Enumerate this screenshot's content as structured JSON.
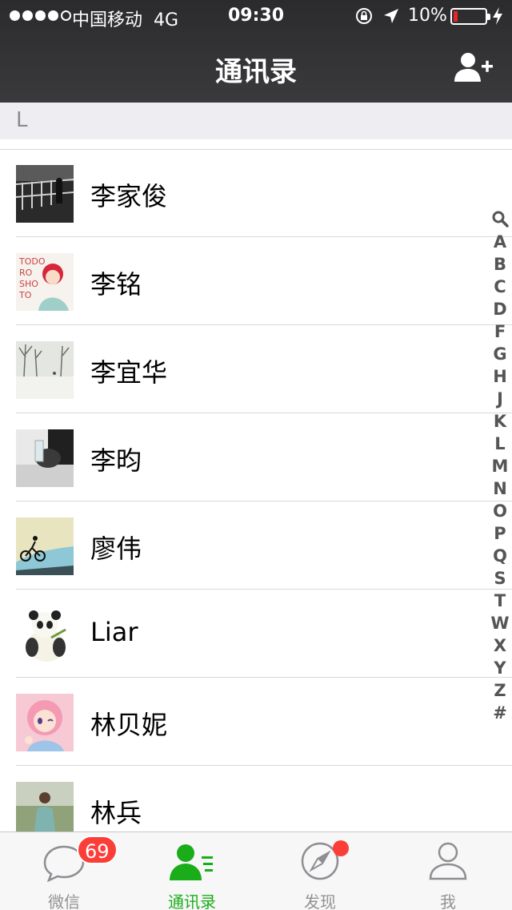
{
  "status_bar": {
    "carrier": "中国移动",
    "network": "4G",
    "time": "09:30",
    "battery_percent": "10%",
    "battery_level": 0.1,
    "signal_bars": 4
  },
  "nav": {
    "title": "通讯录",
    "add_contact_icon": "add-person-icon"
  },
  "section": {
    "letter": "L"
  },
  "contacts": [
    {
      "name": "李家俊",
      "avatar": "night-railing-photo"
    },
    {
      "name": "李铭",
      "avatar": "anime-redhead-todo"
    },
    {
      "name": "李宜华",
      "avatar": "snowy-trees-photo"
    },
    {
      "name": "李昀",
      "avatar": "sleeping-person-photo"
    },
    {
      "name": "廖伟",
      "avatar": "cyclist-silhouette"
    },
    {
      "name": "Liar",
      "avatar": "panda-illustration"
    },
    {
      "name": "林贝妮",
      "avatar": "pink-anime-girl"
    },
    {
      "name": "林兵",
      "avatar": "meditating-woman-photo"
    }
  ],
  "index": {
    "search_icon": "search-icon",
    "letters": [
      "A",
      "B",
      "C",
      "D",
      "F",
      "G",
      "H",
      "J",
      "K",
      "L",
      "M",
      "N",
      "O",
      "P",
      "Q",
      "S",
      "T",
      "W",
      "X",
      "Y",
      "Z",
      "#"
    ]
  },
  "tabbar": {
    "tabs": [
      {
        "label": "微信",
        "icon": "chat-bubble-icon",
        "badge": "69"
      },
      {
        "label": "通讯录",
        "icon": "contacts-icon",
        "active": true
      },
      {
        "label": "发现",
        "icon": "compass-icon",
        "dot": true
      },
      {
        "label": "我",
        "icon": "person-icon"
      }
    ]
  },
  "colors": {
    "accent_green": "#1aad19",
    "badge_red": "#fc3e39",
    "nav_bg": "#333335",
    "section_bg": "#ededf2"
  }
}
